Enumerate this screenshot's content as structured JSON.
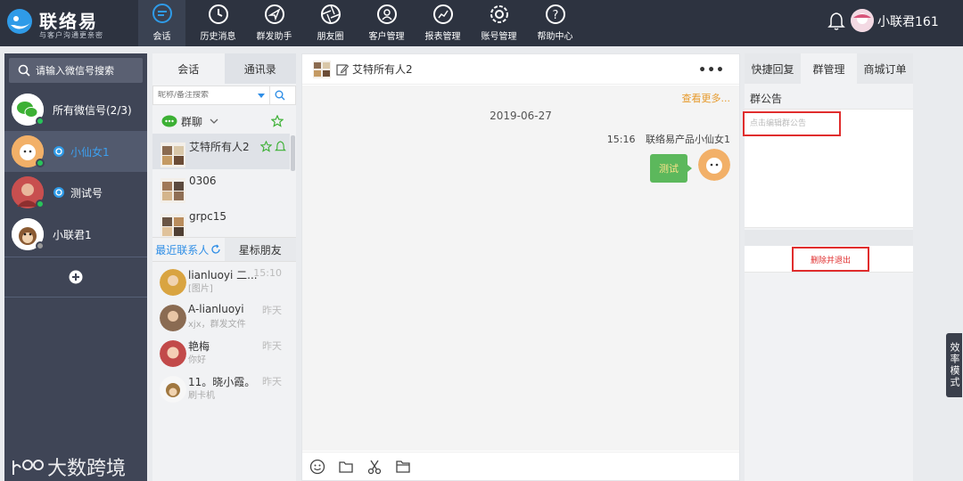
{
  "brand": {
    "name": "联络易",
    "tagline": "与客户沟通更亲密"
  },
  "nav": [
    {
      "id": "chat",
      "label": "会话",
      "icon": "chat-bubble-icon",
      "active": true
    },
    {
      "id": "history",
      "label": "历史消息",
      "icon": "clock-icon"
    },
    {
      "id": "broadcast",
      "label": "群发助手",
      "icon": "send-icon"
    },
    {
      "id": "moments",
      "label": "朋友圈",
      "icon": "aperture-icon"
    },
    {
      "id": "customers",
      "label": "客户管理",
      "icon": "person-icon"
    },
    {
      "id": "reports",
      "label": "报表管理",
      "icon": "chart-icon"
    },
    {
      "id": "accounts",
      "label": "账号管理",
      "icon": "gear-icon"
    },
    {
      "id": "help",
      "label": "帮助中心",
      "icon": "help-icon"
    }
  ],
  "user": {
    "name": "小联君161"
  },
  "left": {
    "search_label": "请输入微信号搜索",
    "accounts": [
      {
        "name": "所有微信号(2/3)",
        "status": "online"
      },
      {
        "name": "小仙女1",
        "status": "online",
        "wx": true,
        "active": true
      },
      {
        "name": "测试号",
        "status": "online",
        "wx": true
      },
      {
        "name": "小联君1",
        "status": "offline"
      }
    ],
    "watermark": "大数跨境"
  },
  "contacts": {
    "tabs": [
      "会话",
      "通讯录"
    ],
    "search_placeholder": "昵称/备注搜索",
    "group_label": "群聊",
    "groups": [
      {
        "name": "艾特所有人2",
        "selected": true
      },
      {
        "name": "0306"
      },
      {
        "name": "grpc15"
      }
    ],
    "recent_tabs": [
      "最近联系人",
      "星标朋友"
    ],
    "recent": [
      {
        "name": "lianluoyi 二...",
        "msg": "[图片]",
        "time": "15:10",
        "color": "#d9a441"
      },
      {
        "name": "A-lianluoyi",
        "msg": "xjx，群发文件",
        "time": "昨天",
        "color": "#8a6b52"
      },
      {
        "name": "艳梅",
        "msg": "你好",
        "time": "昨天",
        "color": "#c24a4a"
      },
      {
        "name": "11。晓小霞。",
        "msg": "刷卡机",
        "time": "昨天",
        "color": "#a0773f"
      }
    ]
  },
  "chat": {
    "title": "艾特所有人2",
    "more_dots": "•••",
    "more_link": "查看更多...",
    "date": "2019-06-27",
    "message": {
      "time": "15:16",
      "sender": "联络易产品小仙女1",
      "text": "测试"
    }
  },
  "right": {
    "tabs": [
      "快捷回复",
      "群管理",
      "商城订单"
    ],
    "notice_title": "群公告",
    "notice_placeholder": "点击编辑群公告",
    "quit_label": "删除并退出"
  },
  "efficiency_mode": "效率模式",
  "colors": {
    "topbar": "#2d3340",
    "sidebar": "#3f4556",
    "accent_green": "#28c45a",
    "highlight_red": "#e02d2d",
    "link_orange": "#e69a2c"
  }
}
